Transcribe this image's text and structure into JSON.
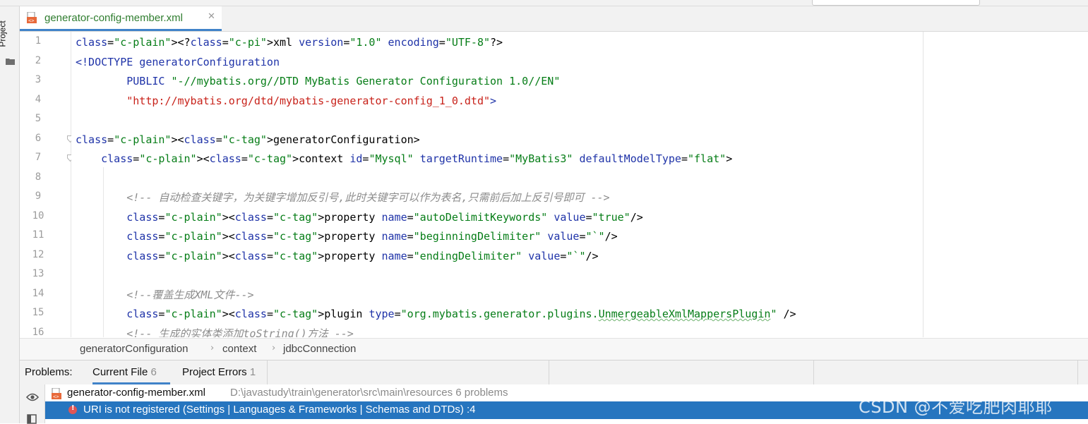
{
  "colors": {
    "accent": "#4083c9",
    "selection": "#2675bf",
    "xml_tag": "#1f33a8",
    "xml_value": "#067d17",
    "xml_url": "#c8221a",
    "comment": "#8c8c8c"
  },
  "left_toolbar": {
    "project_label": "Project",
    "folder_icon": "folder-icon"
  },
  "editor": {
    "tab": {
      "label": "generator-config-member.xml",
      "icon": "xml-file-icon",
      "close_icon": "close-icon"
    },
    "line_numbers": [
      "1",
      "2",
      "3",
      "4",
      "5",
      "6",
      "7",
      "8",
      "9",
      "10",
      "11",
      "12",
      "13",
      "14",
      "15",
      "16"
    ],
    "lines": [
      [
        "<?xml version=\"1.0\" encoding=\"UTF-8\"?>"
      ],
      [
        "<!DOCTYPE generatorConfiguration"
      ],
      [
        "        PUBLIC \"-//mybatis.org//DTD MyBatis Generator Configuration 1.0//EN\""
      ],
      [
        "        \"http://mybatis.org/dtd/mybatis-generator-config_1_0.dtd\">"
      ],
      [
        ""
      ],
      [
        "<generatorConfiguration>"
      ],
      [
        "    <context id=\"Mysql\" targetRuntime=\"MyBatis3\" defaultModelType=\"flat\">"
      ],
      [
        ""
      ],
      [
        "        <!-- 自动检查关键字，为关键字增加反引号,此时关键字可以作为表名,只需前后加上反引号即可 -->"
      ],
      [
        "        <property name=\"autoDelimitKeywords\" value=\"true\"/>"
      ],
      [
        "        <property name=\"beginningDelimiter\" value=\"`\"/>"
      ],
      [
        "        <property name=\"endingDelimiter\" value=\"`\"/>"
      ],
      [
        ""
      ],
      [
        "        <!--覆盖生成XML文件-->"
      ],
      [
        "        <plugin type=\"org.mybatis.generator.plugins.UnmergeableXmlMappersPlugin\" />"
      ],
      [
        "        <!-- 生成的实体类添加toString()方法 -->"
      ]
    ]
  },
  "breadcrumb": [
    "generatorConfiguration",
    "context",
    "jdbcConnection"
  ],
  "problems": {
    "title": "Problems:",
    "tabs": [
      {
        "label": "Current File",
        "count": "6"
      },
      {
        "label": "Project Errors",
        "count": "1"
      }
    ],
    "file_row": {
      "name": "generator-config-member.xml",
      "path": "D:\\javastudy\\train\\generator\\src\\main\\resources  6 problems"
    },
    "error_row": {
      "text": "URI is not registered (Settings | Languages & Frameworks | Schemas and DTDs) :4"
    }
  },
  "watermark": "CSDN @不爱吃肥肉耶耶"
}
